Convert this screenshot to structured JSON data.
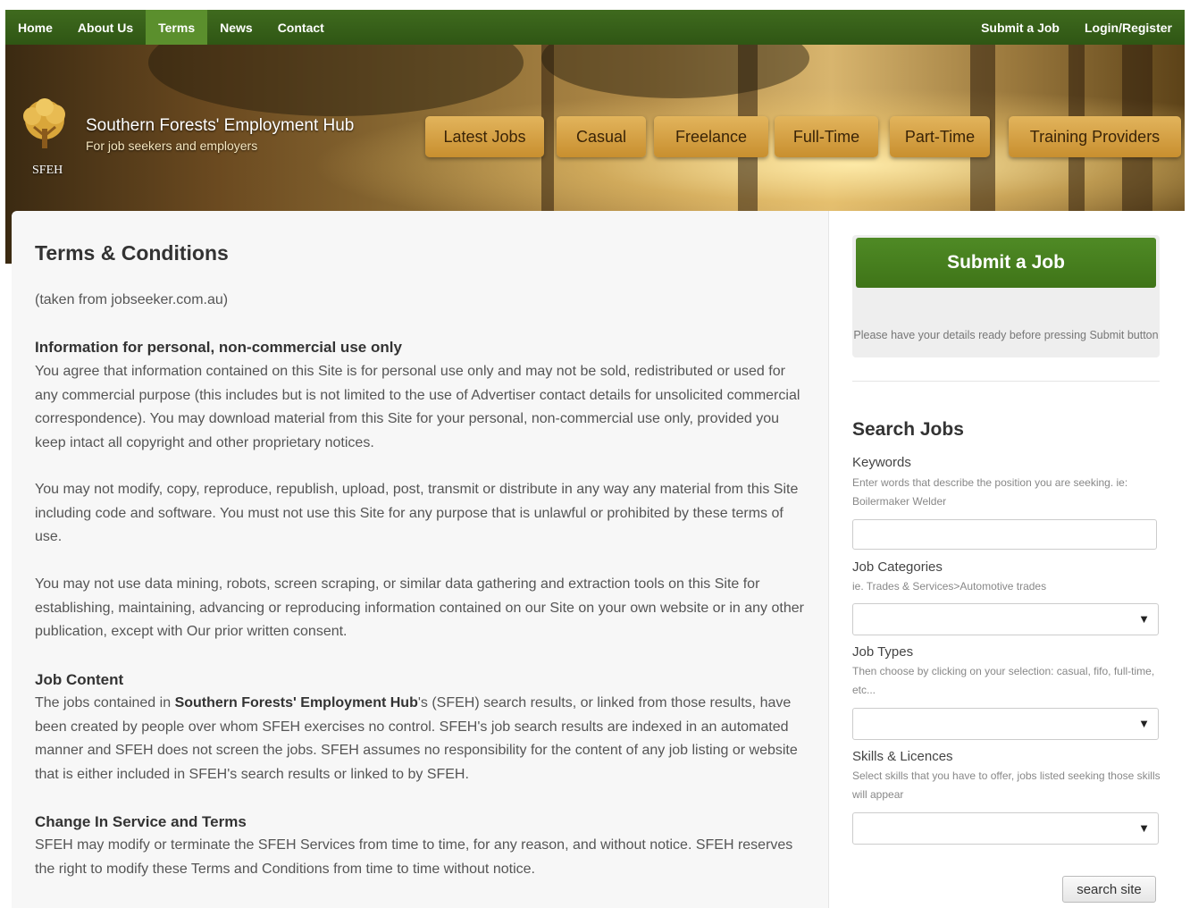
{
  "nav": {
    "left": [
      "Home",
      "About Us",
      "Terms",
      "News",
      "Contact"
    ],
    "active": "Terms",
    "right": [
      "Submit a Job",
      "Login/Register"
    ]
  },
  "banner": {
    "title": "Southern Forests' Employment Hub",
    "subtitle": "For job seekers and employers",
    "abbr": "SFEH",
    "categories": [
      "Latest Jobs",
      "Casual",
      "Freelance",
      "Full-Time",
      "Part-Time",
      "Training Providers"
    ]
  },
  "content": {
    "title": "Terms & Conditions",
    "source": "(taken from jobseeker.com.au)",
    "sections": [
      {
        "heading": "Information for personal, non-commercial use only",
        "paragraphs": [
          "You agree that information contained on this Site is for personal use only and may not be sold, redistributed or used for any commercial purpose (this includes but is not limited to the use of Advertiser contact details for unsolicited commercial correspondence). You may download material from this Site for your personal, non-commercial use only, provided you keep intact all copyright and other proprietary notices.",
          "You may not modify, copy, reproduce, republish, upload, post, transmit or distribute in any way any material from this Site including code and software. You must not use this Site for any purpose that is unlawful or prohibited by these terms of use.",
          "You may not use data mining, robots, screen scraping, or similar data gathering and extraction tools on this Site for establishing, maintaining, advancing or reproducing information contained on our Site on your own website or in any other publication, except with Our prior written consent."
        ]
      },
      {
        "heading": "Job Content",
        "intro": "The jobs contained in",
        "bold": "Southern Forests' Employment Hub",
        "rest": "'s (SFEH) search results, or linked from those results, have been created by people over whom SFEH exercises no control. SFEH's job search results are indexed in an automated manner and SFEH does not screen the jobs. SFEH assumes no responsibility for the content of any job listing or website that is either included in SFEH's search results or linked to by SFEH."
      },
      {
        "heading": "Change In Service and Terms",
        "paragraphs": [
          "SFEH may modify or terminate the SFEH Services from time to time, for any reason, and without notice. SFEH reserves the right to modify these Terms and Conditions from time to time without notice."
        ]
      }
    ]
  },
  "sidebar": {
    "submit_label": "Submit a Job",
    "submit_note": "Please have your details ready before pressing Submit button",
    "search_title": "Search Jobs",
    "keywords": {
      "label": "Keywords",
      "help": "Enter words that describe the position you are seeking. ie: Boilermaker Welder",
      "value": ""
    },
    "categories": {
      "label": "Job Categories",
      "help": "ie. Trades & Services>Automotive trades",
      "value": ""
    },
    "types": {
      "label": "Job Types",
      "help": "Then choose by clicking on your selection: casual, fifo, full-time, etc...",
      "value": ""
    },
    "skills": {
      "label": "Skills & Licences",
      "help": "Select skills that you have to offer, jobs listed seeking those skills will appear",
      "value": ""
    },
    "search_button": "search site",
    "caret": "▼"
  },
  "colors": {
    "nav_green": "#3f6a1e",
    "nav_active": "#5b8f2d",
    "category_gold": "#d6a247",
    "submit_green": "#4a8220"
  }
}
